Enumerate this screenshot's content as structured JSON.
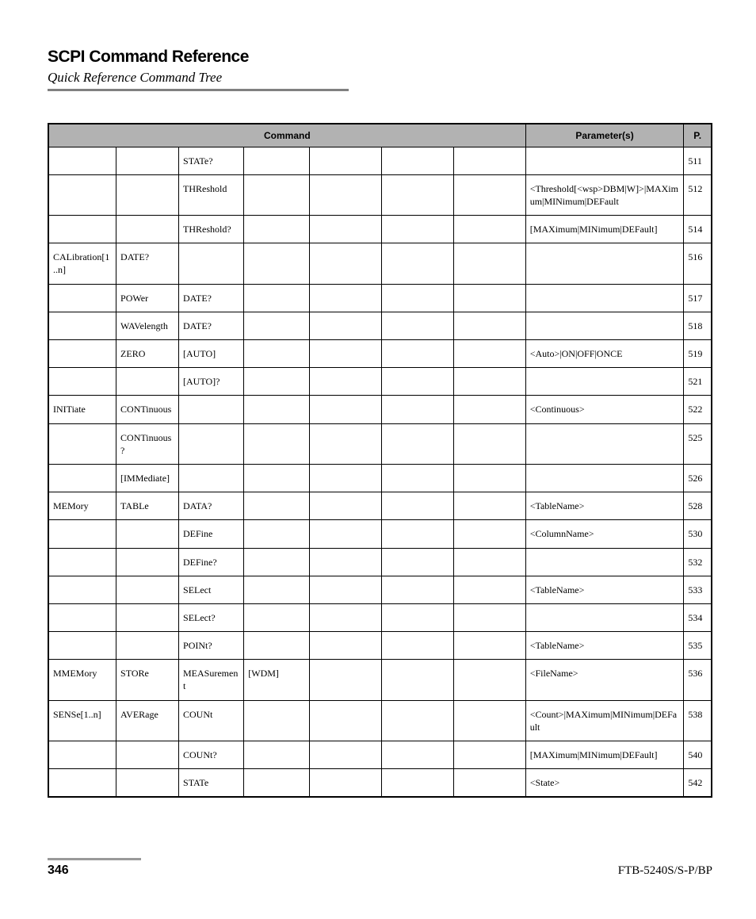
{
  "title": "SCPI Command Reference",
  "subtitle": "Quick Reference Command Tree",
  "headers": {
    "command": "Command",
    "parameters": "Parameter(s)",
    "page": "P."
  },
  "rows": [
    {
      "c1": "",
      "c2": "",
      "c3": "STATe?",
      "c4": "",
      "c5": "",
      "c6": "",
      "c7": "",
      "param": "",
      "page": "511"
    },
    {
      "c1": "",
      "c2": "",
      "c3": "THReshold",
      "c4": "",
      "c5": "",
      "c6": "",
      "c7": "",
      "param": "<Threshold[<wsp>DBM|W]>|MAXimum|MINimum|DEFault",
      "page": "512"
    },
    {
      "c1": "",
      "c2": "",
      "c3": "THReshold?",
      "c4": "",
      "c5": "",
      "c6": "",
      "c7": "",
      "param": "[MAXimum|MINimum|DEFault]",
      "page": "514"
    },
    {
      "c1": "CALibration[1..n]",
      "c2": "DATE?",
      "c3": "",
      "c4": "",
      "c5": "",
      "c6": "",
      "c7": "",
      "param": "",
      "page": "516"
    },
    {
      "c1": "",
      "c2": "POWer",
      "c3": "DATE?",
      "c4": "",
      "c5": "",
      "c6": "",
      "c7": "",
      "param": "",
      "page": "517"
    },
    {
      "c1": "",
      "c2": "WAVelength",
      "c3": "DATE?",
      "c4": "",
      "c5": "",
      "c6": "",
      "c7": "",
      "param": "",
      "page": "518"
    },
    {
      "c1": "",
      "c2": "ZERO",
      "c3": "[AUTO]",
      "c4": "",
      "c5": "",
      "c6": "",
      "c7": "",
      "param": "<Auto>|ON|OFF|ONCE",
      "page": "519"
    },
    {
      "c1": "",
      "c2": "",
      "c3": "[AUTO]?",
      "c4": "",
      "c5": "",
      "c6": "",
      "c7": "",
      "param": "",
      "page": "521"
    },
    {
      "c1": "INITiate",
      "c2": "CONTinuous",
      "c3": "",
      "c4": "",
      "c5": "",
      "c6": "",
      "c7": "",
      "param": "<Continuous>",
      "page": "522"
    },
    {
      "c1": "",
      "c2": "CONTinuous?",
      "c3": "",
      "c4": "",
      "c5": "",
      "c6": "",
      "c7": "",
      "param": "",
      "page": "525"
    },
    {
      "c1": "",
      "c2": "[IMMediate]",
      "c3": "",
      "c4": "",
      "c5": "",
      "c6": "",
      "c7": "",
      "param": "",
      "page": "526"
    },
    {
      "c1": "MEMory",
      "c2": "TABLe",
      "c3": "DATA?",
      "c4": "",
      "c5": "",
      "c6": "",
      "c7": "",
      "param": "<TableName>",
      "page": "528"
    },
    {
      "c1": "",
      "c2": "",
      "c3": "DEFine",
      "c4": "",
      "c5": "",
      "c6": "",
      "c7": "",
      "param": "<ColumnName>",
      "page": "530"
    },
    {
      "c1": "",
      "c2": "",
      "c3": "DEFine?",
      "c4": "",
      "c5": "",
      "c6": "",
      "c7": "",
      "param": "",
      "page": "532"
    },
    {
      "c1": "",
      "c2": "",
      "c3": "SELect",
      "c4": "",
      "c5": "",
      "c6": "",
      "c7": "",
      "param": "<TableName>",
      "page": "533"
    },
    {
      "c1": "",
      "c2": "",
      "c3": "SELect?",
      "c4": "",
      "c5": "",
      "c6": "",
      "c7": "",
      "param": "",
      "page": "534"
    },
    {
      "c1": "",
      "c2": "",
      "c3": "POINt?",
      "c4": "",
      "c5": "",
      "c6": "",
      "c7": "",
      "param": "<TableName>",
      "page": "535"
    },
    {
      "c1": "MMEMory",
      "c2": "STORe",
      "c3": "MEASurement",
      "c4": "[WDM]",
      "c5": "",
      "c6": "",
      "c7": "",
      "param": "<FileName>",
      "page": "536"
    },
    {
      "c1": "SENSe[1..n]",
      "c2": "AVERage",
      "c3": "COUNt",
      "c4": "",
      "c5": "",
      "c6": "",
      "c7": "",
      "param": "<Count>|MAXimum|MINimum|DEFault",
      "page": "538"
    },
    {
      "c1": "",
      "c2": "",
      "c3": "COUNt?",
      "c4": "",
      "c5": "",
      "c6": "",
      "c7": "",
      "param": "[MAXimum|MINimum|DEFault]",
      "page": "540"
    },
    {
      "c1": "",
      "c2": "",
      "c3": "STATe",
      "c4": "",
      "c5": "",
      "c6": "",
      "c7": "",
      "param": "<State>",
      "page": "542"
    }
  ],
  "footer": {
    "page_number": "346",
    "doc_id": "FTB-5240S/S-P/BP"
  }
}
